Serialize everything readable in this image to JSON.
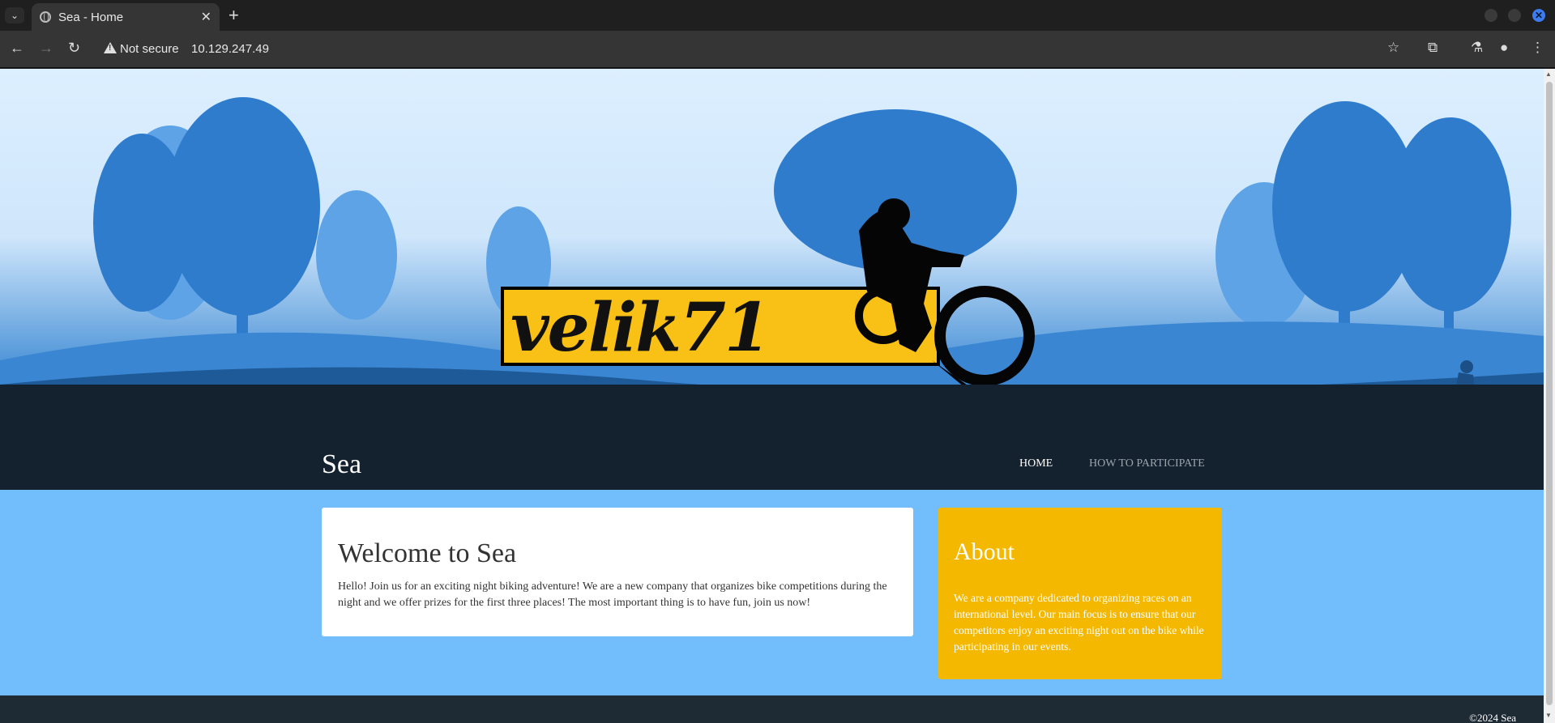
{
  "browser": {
    "tab_title": "Sea - Home",
    "security_label": "Not secure",
    "url": "10.129.247.49"
  },
  "hero": {
    "logo_text": "velik71",
    "logo_color": "#f9c115"
  },
  "site": {
    "title": "Sea",
    "nav": [
      {
        "label": "HOME",
        "active": true
      },
      {
        "label": "HOW TO PARTICIPATE",
        "active": false
      }
    ]
  },
  "welcome": {
    "title": "Welcome to Sea",
    "text": "Hello! Join us for an exciting night biking adventure! We are a new company that organizes bike competitions during the night and we offer prizes for the first three places! The most important thing is to have fun, join us now!"
  },
  "about": {
    "title": "About",
    "text": "We are a company dedicated to organizing races on an international level. Our main focus is to ensure that our competitors enjoy an exciting night out on the bike while participating in our events."
  },
  "footer": {
    "copyright": "©2024 Sea"
  },
  "colors": {
    "page_bg": "#72bdfb",
    "header_band": "#14222f",
    "about_card": "#f4b800",
    "footer": "#1e2a34"
  }
}
